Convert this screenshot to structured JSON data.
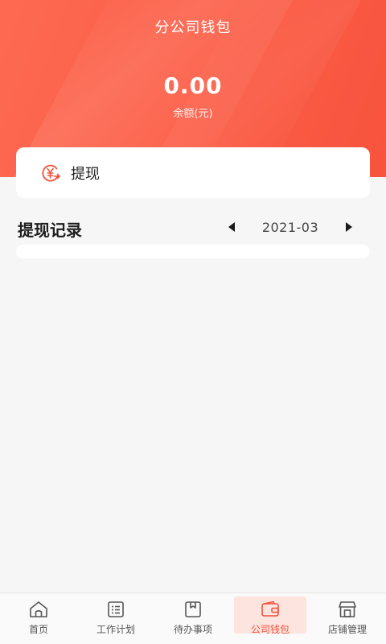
{
  "header": {
    "title": "分公司钱包",
    "balance": "0.00",
    "balance_label": "余额(元)"
  },
  "withdraw": {
    "label": "提现",
    "icon": "yen-transfer-icon"
  },
  "records": {
    "title": "提现记录",
    "date": "2021-03"
  },
  "tabbar": {
    "items": [
      {
        "label": "首页",
        "icon": "home-icon"
      },
      {
        "label": "工作计划",
        "icon": "work-plan-icon"
      },
      {
        "label": "待办事项",
        "icon": "todo-icon"
      },
      {
        "label": "公司钱包",
        "icon": "wallet-icon",
        "active": true
      },
      {
        "label": "店铺管理",
        "icon": "store-icon"
      }
    ]
  },
  "colors": {
    "accent": "#f0533e",
    "header_gradient_start": "#fd6a52",
    "header_gradient_end": "#f7533d",
    "background": "#f6f6f6"
  }
}
